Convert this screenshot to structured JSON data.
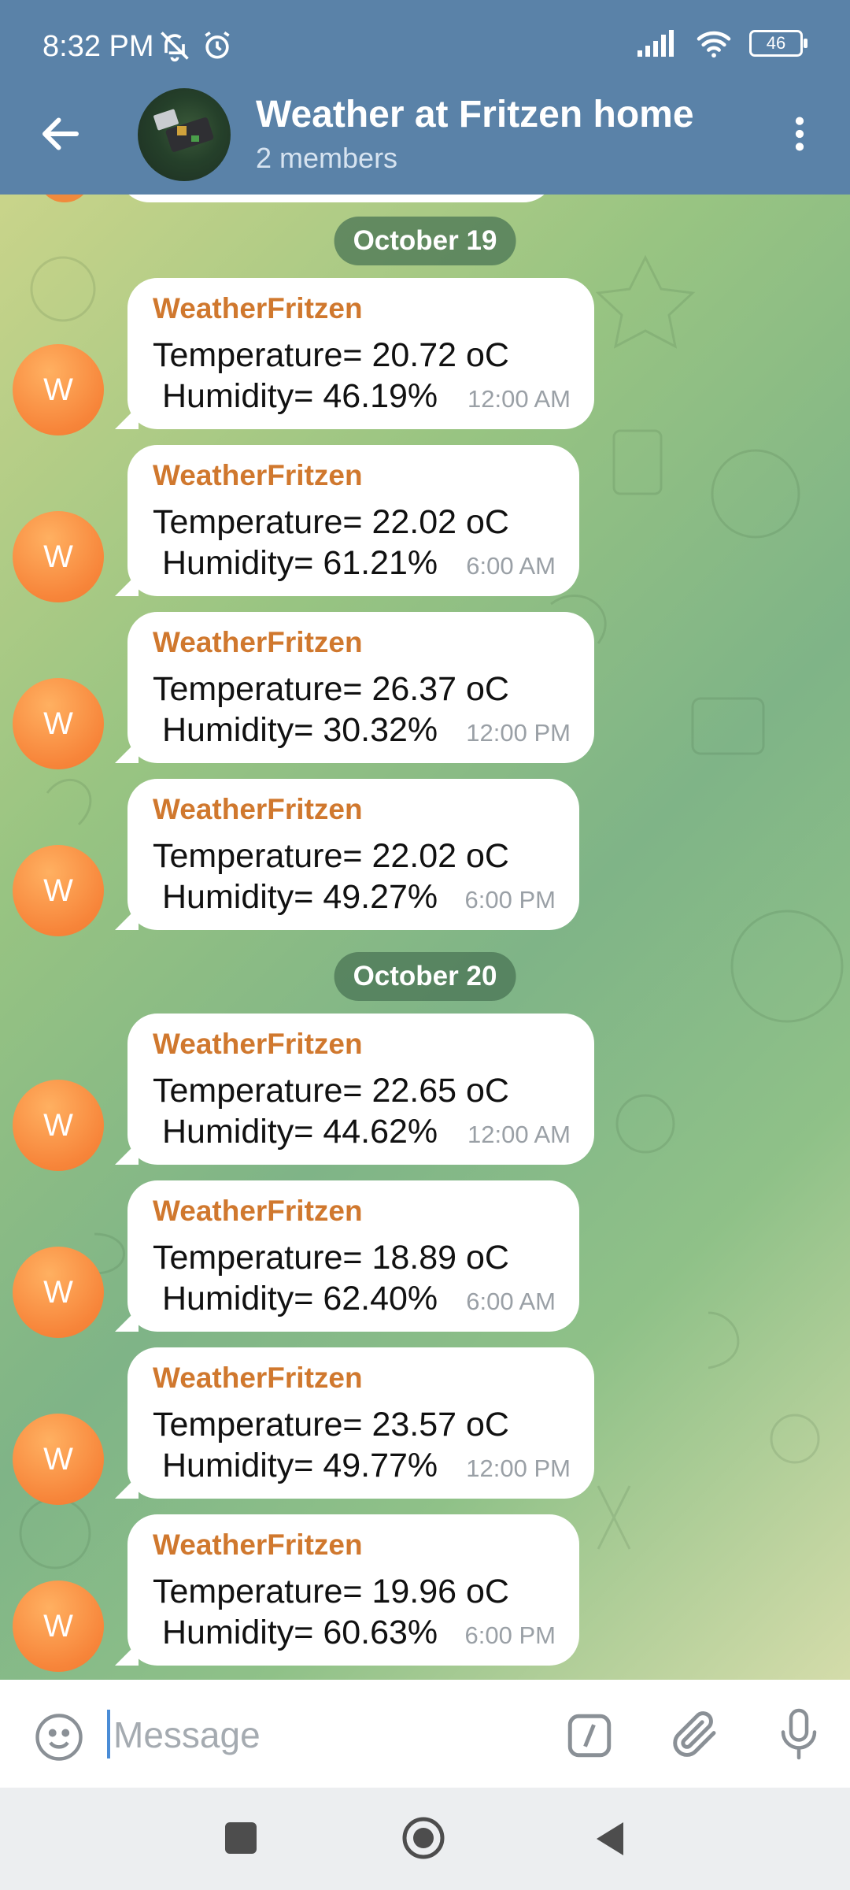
{
  "status_bar": {
    "time": "8:32 PM",
    "battery": "46"
  },
  "header": {
    "title": "Weather at Fritzen home",
    "subtitle": "2 members"
  },
  "colors": {
    "header": "#5a82a8",
    "sender": "#d0782e",
    "avatar": "#f7853a",
    "caret": "#4a8cd6"
  },
  "avatar_letter": "W",
  "dates": [
    "October 19",
    "October 20"
  ],
  "messages": [
    {
      "sender": "WeatherFritzen",
      "line1": "Temperature= 20.72 oC",
      "line2": "Humidity= 46.19%",
      "time": "12:00 AM"
    },
    {
      "sender": "WeatherFritzen",
      "line1": "Temperature= 22.02 oC",
      "line2": "Humidity= 61.21%",
      "time": "6:00 AM"
    },
    {
      "sender": "WeatherFritzen",
      "line1": "Temperature= 26.37 oC",
      "line2": "Humidity= 30.32%",
      "time": "12:00 PM"
    },
    {
      "sender": "WeatherFritzen",
      "line1": "Temperature= 22.02 oC",
      "line2": "Humidity= 49.27%",
      "time": "6:00 PM"
    },
    {
      "sender": "WeatherFritzen",
      "line1": "Temperature= 22.65 oC",
      "line2": "Humidity= 44.62%",
      "time": "12:00 AM"
    },
    {
      "sender": "WeatherFritzen",
      "line1": "Temperature= 18.89 oC",
      "line2": "Humidity= 62.40%",
      "time": "6:00 AM"
    },
    {
      "sender": "WeatherFritzen",
      "line1": "Temperature= 23.57 oC",
      "line2": "Humidity= 49.77%",
      "time": "12:00 PM"
    },
    {
      "sender": "WeatherFritzen",
      "line1": "Temperature= 19.96 oC",
      "line2": "Humidity= 60.63%",
      "time": "6:00 PM"
    }
  ],
  "input": {
    "placeholder": "Message"
  },
  "icons": {
    "back": "arrow-left-icon",
    "menu": "more-vertical-icon",
    "emoji": "smiley-icon",
    "command": "slash-command-icon",
    "attach": "paperclip-icon",
    "mic": "microphone-icon"
  }
}
